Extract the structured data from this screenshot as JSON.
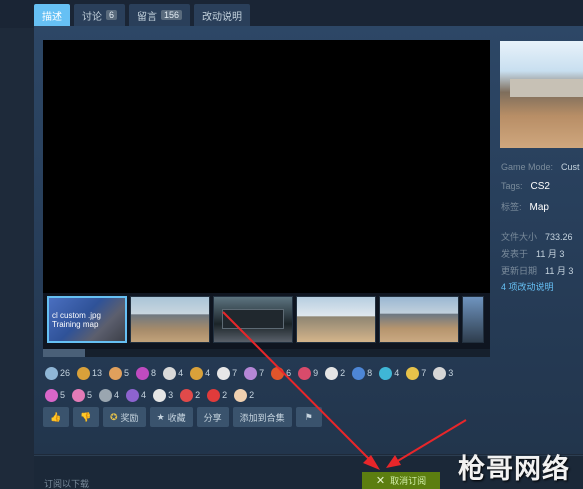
{
  "tabs": [
    {
      "label": "描述",
      "count": ""
    },
    {
      "label": "讨论",
      "count": "6"
    },
    {
      "label": "留言",
      "count": "156"
    },
    {
      "label": "改动说明",
      "count": ""
    }
  ],
  "thumbnails": [
    {
      "caption": "cl custom .jpg\nTraining map"
    },
    {
      "caption": ""
    },
    {
      "caption": ""
    },
    {
      "caption": ""
    },
    {
      "caption": ""
    },
    {
      "caption": ""
    }
  ],
  "awards_row1": [
    {
      "icon": "wings-icon",
      "color": "#8fb6d6",
      "count": "26"
    },
    {
      "icon": "horn-icon",
      "color": "#d9a13a",
      "count": "13"
    },
    {
      "icon": "cookie-icon",
      "color": "#e0a05c",
      "count": "5"
    },
    {
      "icon": "squid-icon",
      "color": "#c04bc0",
      "count": "8"
    },
    {
      "icon": "cloud-icon",
      "color": "#d9d9d9",
      "count": "4"
    },
    {
      "icon": "hammer-icon",
      "color": "#d9a13a",
      "count": "4"
    },
    {
      "icon": "bulb-icon",
      "color": "#e7e7e7",
      "count": "7"
    },
    {
      "icon": "cat-icon",
      "color": "#b586d6",
      "count": "7"
    },
    {
      "icon": "flame-icon",
      "color": "#e0552b",
      "count": "6"
    },
    {
      "icon": "fish-icon",
      "color": "#d84b6b",
      "count": "9"
    },
    {
      "icon": "ghost-icon",
      "color": "#e5e5e5",
      "count": "2"
    },
    {
      "icon": "gift-icon",
      "color": "#4d86d6",
      "count": "8"
    },
    {
      "icon": "wand-icon",
      "color": "#3fb6d6",
      "count": "4"
    },
    {
      "icon": "star-burst-icon",
      "color": "#e6c24a",
      "count": "7"
    },
    {
      "icon": "ghost-face-icon",
      "color": "#d6d6d6",
      "count": "3"
    }
  ],
  "awards_row2": [
    {
      "icon": "heart-icon",
      "color": "#d966c9",
      "count": "5"
    },
    {
      "icon": "mouth-icon",
      "color": "#e37bb7",
      "count": "5"
    },
    {
      "icon": "ball-icon",
      "color": "#9aa6b0",
      "count": "4"
    },
    {
      "icon": "mask-icon",
      "color": "#8d63cf",
      "count": "4"
    },
    {
      "icon": "panda-icon",
      "color": "#e5e5e5",
      "count": "3"
    },
    {
      "icon": "popcorn-icon",
      "color": "#e04a4a",
      "count": "2"
    },
    {
      "icon": "lips-icon",
      "color": "#e03b3b",
      "count": "2"
    },
    {
      "icon": "card-icon",
      "color": "#f0d0b0",
      "count": "2"
    }
  ],
  "actions": {
    "thumbs_up": "👍",
    "thumbs_down": "👎",
    "award": "奖励",
    "favorite": "收藏",
    "share": "分享",
    "add_collection": "添加到合集",
    "flag": "⚑"
  },
  "meta": {
    "game_mode_label": "Game Mode:",
    "game_mode_value": "Cust",
    "tags_label": "Tags:",
    "tags_value": "CS2",
    "tags_cn_label": "标签:",
    "tags_cn_value": "Map",
    "size_label": "文件大小",
    "size_value": "733.26",
    "posted_label": "发表于",
    "posted_value": "11 月 3",
    "updated_label": "更新日期",
    "updated_value": "11 月 3",
    "changelog_link": "4 项改动说明"
  },
  "bottom": {
    "subscribe_label": "订阅以下载",
    "unsubscribe": "取消订阅",
    "unsubscribe_icon": "✕"
  },
  "watermark": "枪哥网络",
  "colors": {
    "accent": "#66c0f4",
    "unsubscribe_bg": "#5c7e10",
    "annotation_arrow": "#e8262a"
  }
}
